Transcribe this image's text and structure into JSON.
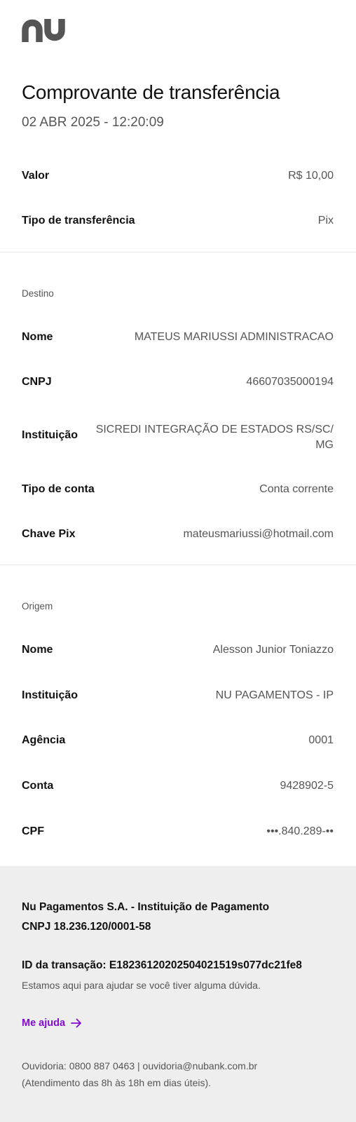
{
  "brand": {
    "logo_icon": "nubank-logo-icon",
    "logo_color": "#555555",
    "accent": "#820ad1"
  },
  "header": {
    "title": "Comprovante de transferência",
    "datetime": "02 ABR 2025 - 12:20:09"
  },
  "summary": {
    "amount_label": "Valor",
    "amount_value": "R$ 10,00",
    "type_label": "Tipo de transferência",
    "type_value": "Pix"
  },
  "destination": {
    "section_label": "Destino",
    "name_label": "Nome",
    "name_value": "MATEUS MARIUSSI ADMINISTRACAO",
    "doc_label": "CNPJ",
    "doc_value": "46607035000194",
    "institution_label": "Instituição",
    "institution_value": "SICREDI INTEGRAÇÃO DE ESTADOS RS/SC/ MG",
    "account_type_label": "Tipo de conta",
    "account_type_value": "Conta corrente",
    "pix_key_label": "Chave Pix",
    "pix_key_value": "mateusmariussi@hotmail.com"
  },
  "origin": {
    "section_label": "Origem",
    "name_label": "Nome",
    "name_value": "Alesson Junior Toniazzo",
    "institution_label": "Instituição",
    "institution_value": "NU PAGAMENTOS - IP",
    "agency_label": "Agência",
    "agency_value": "0001",
    "account_label": "Conta",
    "account_value": "9428902-5",
    "cpf_label": "CPF",
    "cpf_value": "•••.840.289-••"
  },
  "footer": {
    "company_name": "Nu Pagamentos S.A. - Instituição de Pagamento",
    "company_cnpj": "CNPJ 18.236.120/0001-58",
    "transaction_id": "ID da transação: E18236120202504021519s077dc21fe8",
    "help_text": "Estamos aqui para ajudar se você tiver alguma dúvida.",
    "help_link": "Me ajuda",
    "help_link_icon": "arrow-right-icon",
    "ombudsman_line1": "Ouvidoria: 0800 887 0463 | ouvidoria@nubank.com.br",
    "ombudsman_line2": "(Atendimento das 8h às 18h em dias úteis)."
  }
}
